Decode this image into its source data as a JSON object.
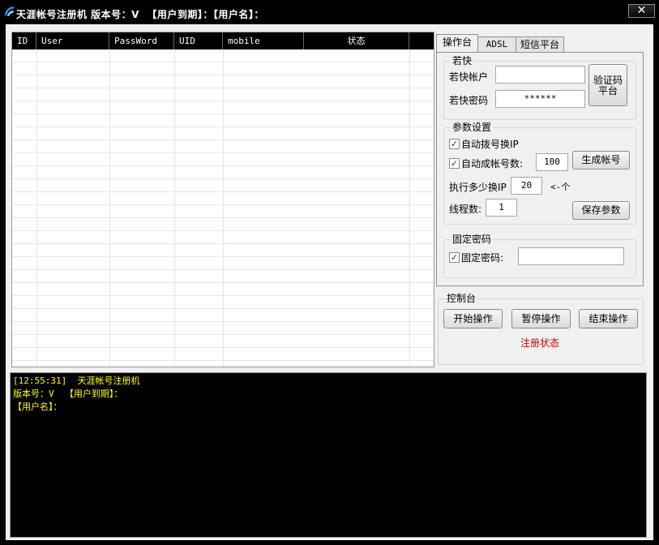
{
  "window": {
    "title": "天涯帐号注册机 版本号：V  【用户到期】：【用户名】：",
    "close_label": "✕"
  },
  "grid": {
    "columns": [
      "ID",
      "User",
      "PassWord",
      "UID",
      "mobile",
      "状态"
    ]
  },
  "tabs": [
    "操作台",
    "ADSL",
    "短信平台"
  ],
  "ruokuai": {
    "group_title": "若快",
    "account_label": "若快帐户",
    "account_value": "",
    "password_label": "若快密码",
    "password_value": "******",
    "captcha_button": "验证码平台"
  },
  "params": {
    "group_title": "参数设置",
    "auto_dial_label": "自动拨号换IP",
    "auto_gen_label": "自动成帐号数:",
    "auto_gen_count": "100",
    "generate_button": "生成帐号",
    "switch_ip_label": "执行多少换IP",
    "switch_ip_value": "20",
    "switch_ip_unit": "<-个",
    "threads_label": "线程数:",
    "threads_value": "1",
    "save_button": "保存参数"
  },
  "fixed_password": {
    "group_title": "固定密码",
    "label": "固定密码:",
    "value": ""
  },
  "console": {
    "group_title": "控制台",
    "start_button": "开始操作",
    "pause_button": "暂停操作",
    "end_button": "结束操作",
    "status": "注册状态"
  },
  "log": {
    "lines": [
      "[12:55:31]  天涯帐号注册机",
      "版本号：V  【用户到期】：",
      "【用户名】："
    ]
  },
  "colors": {
    "log_text": "#ffff00",
    "status_text": "#d00000",
    "background": "#f0f0f0"
  }
}
